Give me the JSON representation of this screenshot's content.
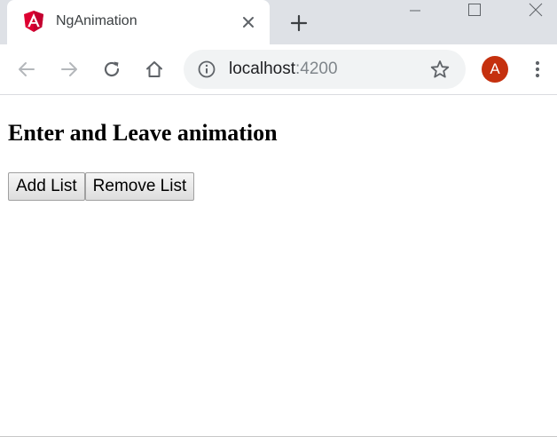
{
  "browser": {
    "tab": {
      "title": "NgAnimation",
      "favicon": "angular-logo-icon"
    },
    "address_bar": {
      "host": "localhost",
      "port": ":4200"
    },
    "profile": {
      "initial": "A",
      "color": "#c5300e"
    },
    "icons": {
      "back": "back-arrow-icon",
      "forward": "forward-arrow-icon",
      "reload": "reload-icon",
      "home": "home-icon",
      "info": "info-icon",
      "star": "star-icon",
      "menu": "kebab-menu-icon",
      "close_tab": "close-icon",
      "new_tab": "plus-icon"
    }
  },
  "page": {
    "heading": "Enter and Leave animation",
    "buttons": {
      "add": "Add List",
      "remove": "Remove List"
    }
  }
}
